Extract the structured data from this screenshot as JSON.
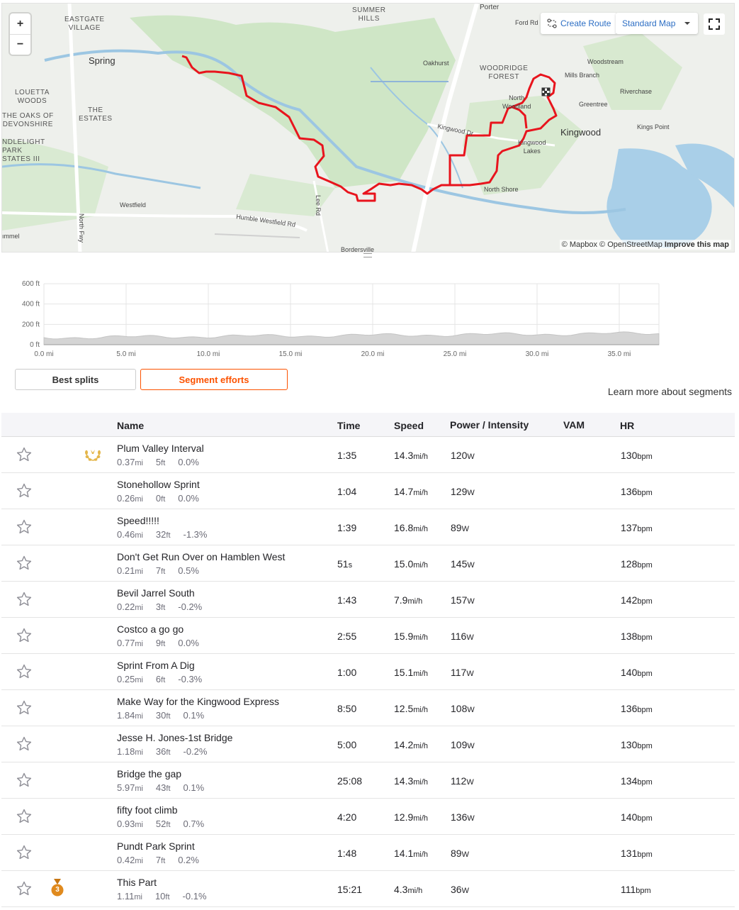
{
  "map": {
    "zoom_in": "+",
    "zoom_out": "−",
    "create_route": "Create Route",
    "map_style": "Standard Map",
    "attribution_mapbox": "© Mapbox",
    "attribution_osm": "© OpenStreetMap",
    "attribution_improve": "Improve this map",
    "labels": {
      "summer_hills": "SUMMER\nHILLS",
      "porter": "Porter",
      "eastgate": "EASTGATE\nVILLAGE",
      "spring": "Spring",
      "oakhurst": "Oakhurst",
      "woodridge": "WOODRIDGE\nFOREST",
      "woodstream": "Woodstream",
      "mills_branch": "Mills Branch",
      "louetta": "LOUETTA\nWOODS",
      "the_estates": "THE\nESTATES",
      "oaks_devonshire": "THE OAKS OF\nDEVONSHIRE",
      "riverchase": "Riverchase",
      "greentree": "Greentree",
      "north_woodland": "North\nWoodland",
      "kingwood_dr": "Kingwood Dr",
      "kingwood": "Kingwood",
      "kings_point": "Kings Point",
      "ndlelight": "NDLELIGHT\nPARK\nSTATES III",
      "kingwood_lakes": "Kingwood\nLakes",
      "north_shore": "North Shore",
      "lee_rd": "Lee Rd",
      "westfield": "Westfield",
      "humble_westfield": "Humble Westfield Rd",
      "north_fwy": "North Fwy",
      "ford_rd": "Ford Rd",
      "mmel": "ımmel",
      "bordersville": "Bordersville"
    }
  },
  "elevation": {
    "y_ticks": [
      "600 ft",
      "400 ft",
      "200 ft",
      "0 ft"
    ],
    "x_ticks": [
      "0.0 mi",
      "5.0 mi",
      "10.0 mi",
      "15.0 mi",
      "20.0 mi",
      "25.0 mi",
      "30.0 mi",
      "35.0 mi"
    ]
  },
  "tabs": {
    "best_splits": "Best splits",
    "segment_efforts": "Segment efforts"
  },
  "learn_more": "Learn more about segments",
  "table": {
    "headers": {
      "name": "Name",
      "time": "Time",
      "speed": "Speed",
      "power": "Power / Intensity",
      "vam": "VAM",
      "hr": "HR"
    },
    "units": {
      "mi": "mi",
      "ft": "ft",
      "speed": "mi/h",
      "power": "W",
      "hr": "bpm",
      "sec": "s"
    },
    "rows": [
      {
        "name": "Plum Valley Interval",
        "dist": "0.37",
        "elev": "5",
        "grade": "0.0%",
        "time": "1:35",
        "speed": "14.3",
        "power": "120",
        "hr": "130",
        "award": "laurel"
      },
      {
        "name": "Stonehollow Sprint",
        "dist": "0.26",
        "elev": "0",
        "grade": "0.0%",
        "time": "1:04",
        "speed": "14.7",
        "power": "129",
        "hr": "136",
        "award": ""
      },
      {
        "name": "Speed!!!!!",
        "dist": "0.46",
        "elev": "32",
        "grade": "-1.3%",
        "time": "1:39",
        "speed": "16.8",
        "power": "89",
        "hr": "137",
        "award": ""
      },
      {
        "name": "Don't Get Run Over on Hamblen West",
        "dist": "0.21",
        "elev": "7",
        "grade": "0.5%",
        "time": "51",
        "time_unit": "s",
        "speed": "15.0",
        "power": "145",
        "hr": "128",
        "award": ""
      },
      {
        "name": "Bevil Jarrel South",
        "dist": "0.22",
        "elev": "3",
        "grade": "-0.2%",
        "time": "1:43",
        "speed": "7.9",
        "power": "157",
        "hr": "142",
        "award": ""
      },
      {
        "name": "Costco a go go",
        "dist": "0.77",
        "elev": "9",
        "grade": "0.0%",
        "time": "2:55",
        "speed": "15.9",
        "power": "116",
        "hr": "138",
        "award": ""
      },
      {
        "name": "Sprint From A Dig",
        "dist": "0.25",
        "elev": "6",
        "grade": "-0.3%",
        "time": "1:00",
        "speed": "15.1",
        "power": "117",
        "hr": "140",
        "award": ""
      },
      {
        "name": "Make Way for the Kingwood Express",
        "dist": "1.84",
        "elev": "30",
        "grade": "0.1%",
        "time": "8:50",
        "speed": "12.5",
        "power": "108",
        "hr": "136",
        "award": ""
      },
      {
        "name": "Jesse H. Jones-1st Bridge",
        "dist": "1.18",
        "elev": "36",
        "grade": "-0.2%",
        "time": "5:00",
        "speed": "14.2",
        "power": "109",
        "hr": "130",
        "award": ""
      },
      {
        "name": "Bridge the gap",
        "dist": "5.97",
        "elev": "43",
        "grade": "0.1%",
        "time": "25:08",
        "speed": "14.3",
        "power": "112",
        "hr": "134",
        "award": ""
      },
      {
        "name": "fifty foot climb",
        "dist": "0.93",
        "elev": "52",
        "grade": "0.7%",
        "time": "4:20",
        "speed": "12.9",
        "power": "136",
        "hr": "140",
        "award": ""
      },
      {
        "name": "Pundt Park Sprint",
        "dist": "0.42",
        "elev": "7",
        "grade": "0.2%",
        "time": "1:48",
        "speed": "14.1",
        "power": "89",
        "hr": "131",
        "award": ""
      },
      {
        "name": "This Part",
        "dist": "1.11",
        "elev": "10",
        "grade": "-0.1%",
        "time": "15:21",
        "speed": "4.3",
        "power": "36",
        "hr": "111",
        "award": "medal",
        "medal_text": "3"
      }
    ]
  },
  "colors": {
    "accent": "#fc5200",
    "route": "#e8141d",
    "link": "#2c6ec4",
    "medal": "#e08a1e",
    "laurel": "#e4b64a"
  }
}
